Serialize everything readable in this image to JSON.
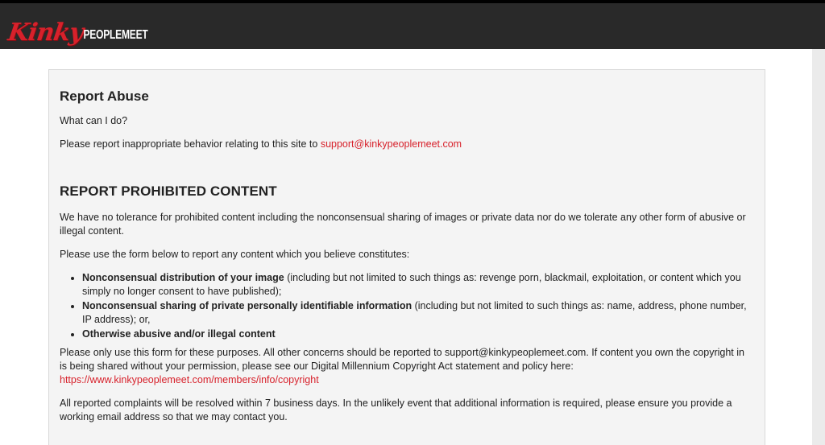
{
  "header": {
    "logo_script": "Kinky",
    "logo_brand": "PEOPLEMEET"
  },
  "report_abuse": {
    "title": "Report Abuse",
    "question": "What can I do?",
    "report_text": "Please report inappropriate behavior relating to this site to ",
    "email_link": "support@kinkypeoplemeet.com"
  },
  "prohibited": {
    "title": "REPORT PROHIBITED CONTENT",
    "intro": "We have no tolerance for prohibited content including the nonconsensual sharing of images or private data nor do we tolerate any other form of abusive or illegal content.",
    "form_text": "Please use the form below to report any content which you believe constitutes:",
    "items": [
      {
        "bold": "Nonconsensual distribution of your image",
        "rest": " (including but not limited to such things as: revenge porn, blackmail, exploitation, or content which you simply no longer consent to have published);"
      },
      {
        "bold": "Nonconsensual sharing of private personally identifiable information",
        "rest": " (including but not limited to such things as: name, address, phone number, IP address); or,"
      },
      {
        "bold": "Otherwise abusive and/or illegal content",
        "rest": ""
      }
    ],
    "purposes_text": "Please only use this form for these purposes. All other concerns should be reported to support@kinkypeoplemeet.com. If content you own the copyright in is being shared without your permission, please see our Digital Millennium Copyright Act statement and policy here:",
    "copyright_link": "https://www.kinkypeoplemeet.com/members/info/copyright",
    "resolution_text": "All reported complaints will be resolved within 7 business days. In the unlikely event that additional information is required, please ensure you provide a working email address so that we may contact you."
  },
  "colors": {
    "accent_red": "#d7212b",
    "header_bg": "#292929",
    "box_bg": "#f4f4f4"
  }
}
